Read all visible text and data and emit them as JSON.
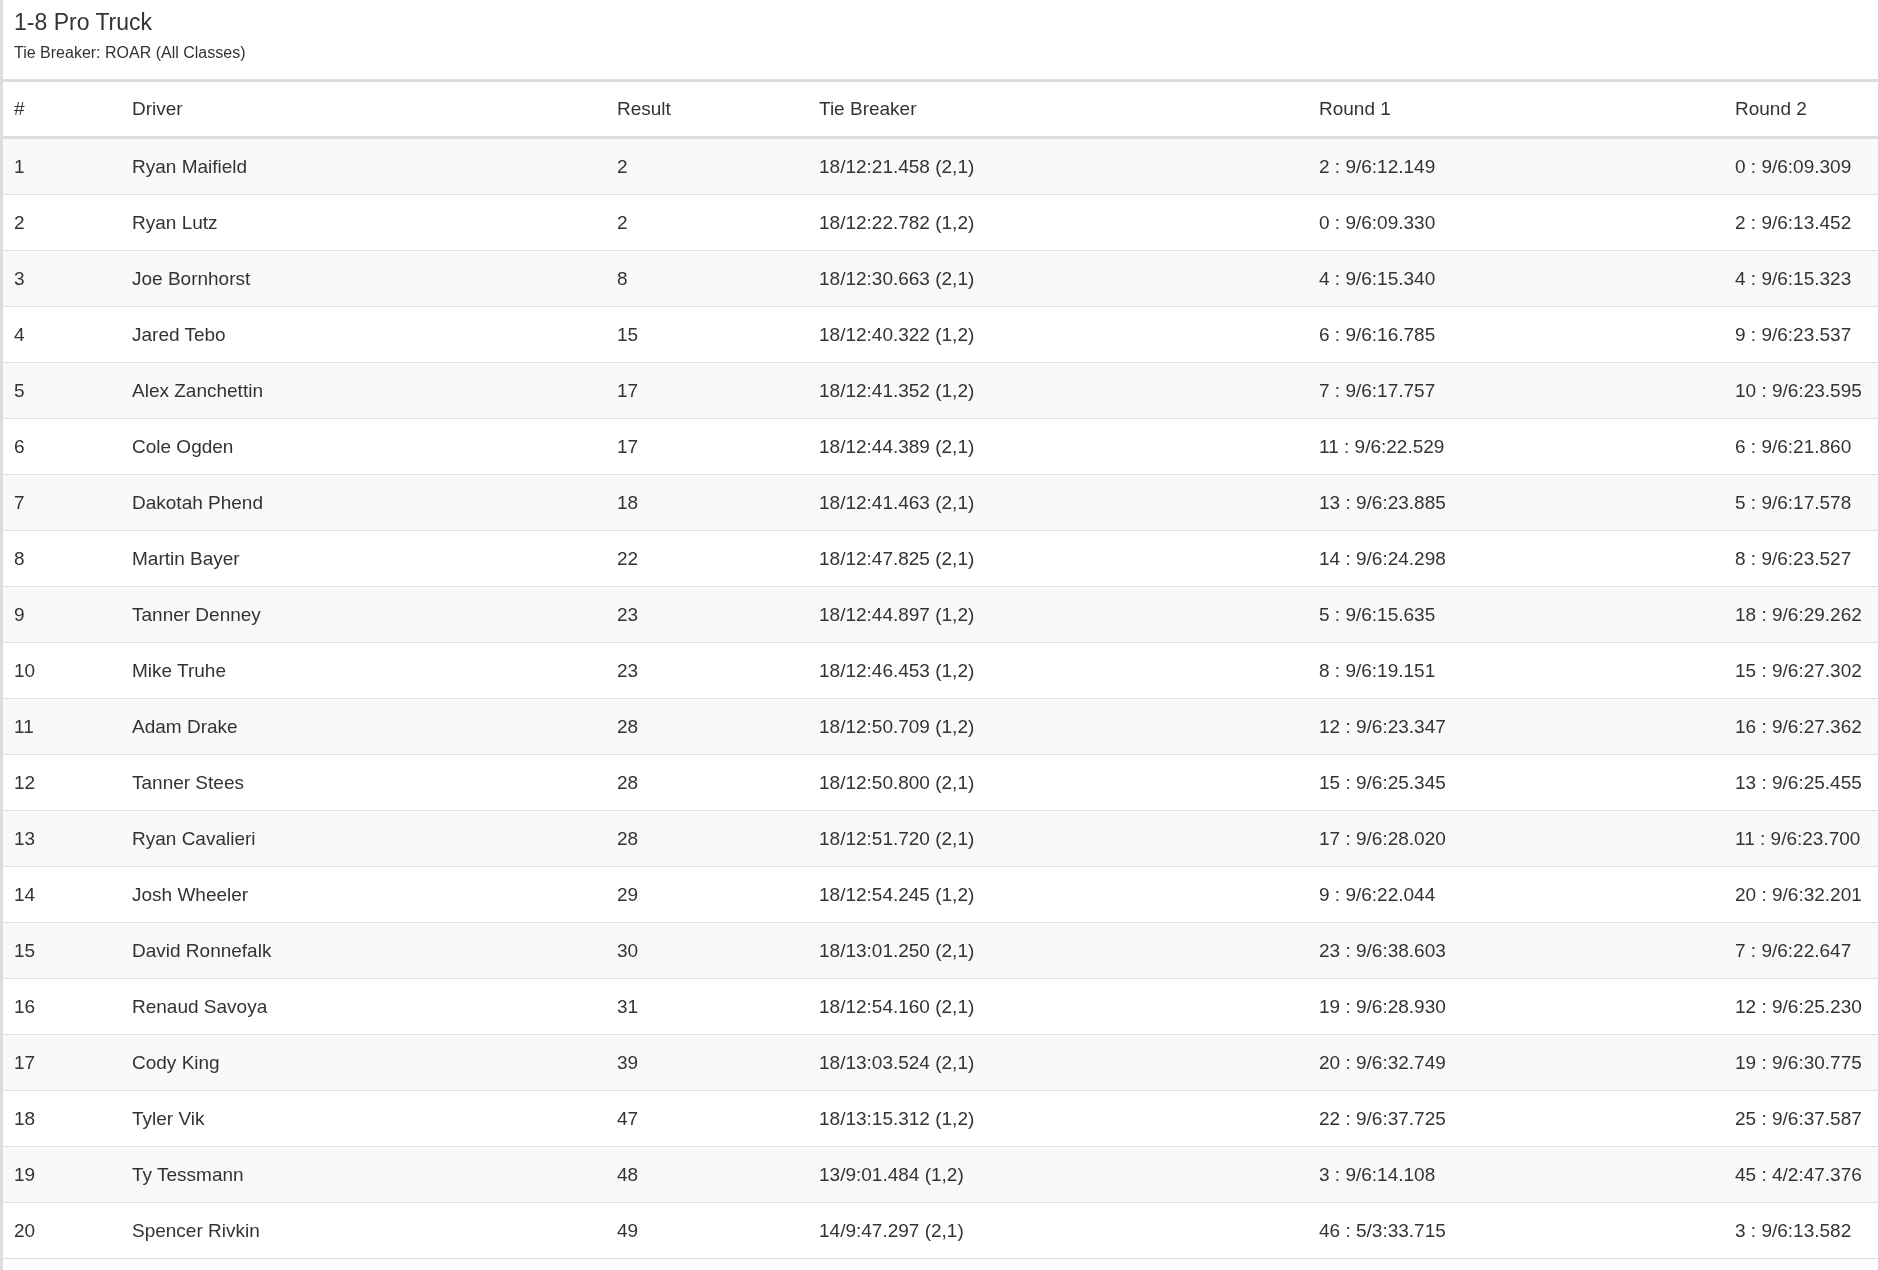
{
  "title": "1-8 Pro Truck",
  "subtitle": "Tie Breaker: ROAR (All Classes)",
  "table": {
    "columns": [
      "#",
      "Driver",
      "Result",
      "Tie Breaker",
      "Round 1",
      "Round 2"
    ],
    "rows": [
      [
        "1",
        "Ryan Maifield",
        "2",
        "18/12:21.458 (2,1)",
        "2 : 9/6:12.149",
        "0 : 9/6:09.309"
      ],
      [
        "2",
        "Ryan Lutz",
        "2",
        "18/12:22.782 (1,2)",
        "0 : 9/6:09.330",
        "2 : 9/6:13.452"
      ],
      [
        "3",
        "Joe Bornhorst",
        "8",
        "18/12:30.663 (2,1)",
        "4 : 9/6:15.340",
        "4 : 9/6:15.323"
      ],
      [
        "4",
        "Jared Tebo",
        "15",
        "18/12:40.322 (1,2)",
        "6 : 9/6:16.785",
        "9 : 9/6:23.537"
      ],
      [
        "5",
        "Alex Zanchettin",
        "17",
        "18/12:41.352 (1,2)",
        "7 : 9/6:17.757",
        "10 : 9/6:23.595"
      ],
      [
        "6",
        "Cole Ogden",
        "17",
        "18/12:44.389 (2,1)",
        "11 : 9/6:22.529",
        "6 : 9/6:21.860"
      ],
      [
        "7",
        "Dakotah Phend",
        "18",
        "18/12:41.463 (2,1)",
        "13 : 9/6:23.885",
        "5 : 9/6:17.578"
      ],
      [
        "8",
        "Martin Bayer",
        "22",
        "18/12:47.825 (2,1)",
        "14 : 9/6:24.298",
        "8 : 9/6:23.527"
      ],
      [
        "9",
        "Tanner Denney",
        "23",
        "18/12:44.897 (1,2)",
        "5 : 9/6:15.635",
        "18 : 9/6:29.262"
      ],
      [
        "10",
        "Mike Truhe",
        "23",
        "18/12:46.453 (1,2)",
        "8 : 9/6:19.151",
        "15 : 9/6:27.302"
      ],
      [
        "11",
        "Adam Drake",
        "28",
        "18/12:50.709 (1,2)",
        "12 : 9/6:23.347",
        "16 : 9/6:27.362"
      ],
      [
        "12",
        "Tanner Stees",
        "28",
        "18/12:50.800 (2,1)",
        "15 : 9/6:25.345",
        "13 : 9/6:25.455"
      ],
      [
        "13",
        "Ryan Cavalieri",
        "28",
        "18/12:51.720 (2,1)",
        "17 : 9/6:28.020",
        "11 : 9/6:23.700"
      ],
      [
        "14",
        "Josh Wheeler",
        "29",
        "18/12:54.245 (1,2)",
        "9 : 9/6:22.044",
        "20 : 9/6:32.201"
      ],
      [
        "15",
        "David Ronnefalk",
        "30",
        "18/13:01.250 (2,1)",
        "23 : 9/6:38.603",
        "7 : 9/6:22.647"
      ],
      [
        "16",
        "Renaud Savoya",
        "31",
        "18/12:54.160 (2,1)",
        "19 : 9/6:28.930",
        "12 : 9/6:25.230"
      ],
      [
        "17",
        "Cody King",
        "39",
        "18/13:03.524 (2,1)",
        "20 : 9/6:32.749",
        "19 : 9/6:30.775"
      ],
      [
        "18",
        "Tyler Vik",
        "47",
        "18/13:15.312 (1,2)",
        "22 : 9/6:37.725",
        "25 : 9/6:37.587"
      ],
      [
        "19",
        "Ty Tessmann",
        "48",
        "13/9:01.484 (1,2)",
        "3 : 9/6:14.108",
        "45 : 4/2:47.376"
      ],
      [
        "20",
        "Spencer Rivkin",
        "49",
        "14/9:47.297 (2,1)",
        "46 : 5/3:33.715",
        "3 : 9/6:13.582"
      ]
    ]
  }
}
